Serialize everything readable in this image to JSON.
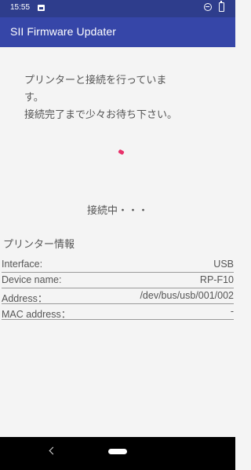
{
  "status_bar": {
    "time": "15:55",
    "icons": [
      "image-icon",
      "do-not-disturb-icon",
      "battery-icon"
    ]
  },
  "app_bar": {
    "title": "SII Firmware Updater",
    "color": "#3646a8"
  },
  "message": {
    "line1": "プリンターと接続を行っていま",
    "line2": "す。",
    "line3": "接続完了まで少々お待ち下さい。"
  },
  "progress": {
    "indicator": "spinner",
    "color": "#e8336b"
  },
  "status_text": "接続中・・・",
  "printer_info": {
    "title": "プリンター情報",
    "rows": [
      {
        "label": "Interface:",
        "value": "USB"
      },
      {
        "label": "Device name:",
        "value": "RP-F10"
      },
      {
        "label": "Address：",
        "value": "/dev/bus/usb/001/002"
      },
      {
        "label": "MAC address：",
        "value": "-"
      }
    ]
  },
  "nav_bar": {
    "icons": [
      "back-icon",
      "home-pill"
    ]
  }
}
